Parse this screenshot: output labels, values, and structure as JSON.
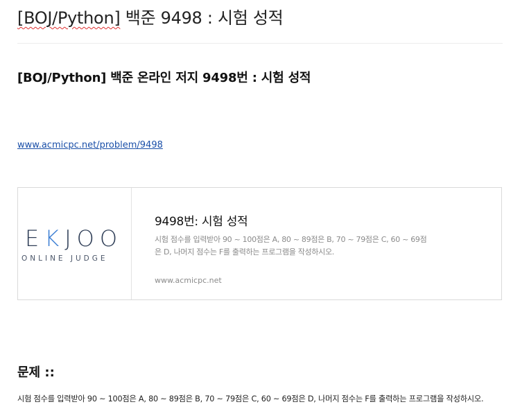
{
  "post": {
    "title_prefix": "[BOJ/Python]",
    "title_rest": " 백준 9498 : 시험 성적",
    "subheading": "[BOJ/Python] 백준 온라인 저지 9498번 : 시험 성적",
    "link_text": "www.acmicpc.net/problem/9498"
  },
  "card": {
    "logo_main_pre": "E",
    "logo_main_k": "K",
    "logo_main_post": "JOO",
    "logo_sub": "ONLINE JUDGE",
    "title": "9498번: 시험 성적",
    "description": "시험 점수를 입력받아 90 ~ 100점은 A, 80 ~ 89점은 B, 70 ~ 79점은 C, 60 ~ 69점은 D, 나머지 점수는 F를 출력하는 프로그램을 작성하시오.",
    "url": "www.acmicpc.net"
  },
  "section": {
    "heading": "문제 ::",
    "body": "시험 점수를 입력받아 90 ~ 100점은 A, 80 ~ 89점은 B, 70 ~ 79점은 C, 60 ~ 69점은 D, 나머지 점수는 F를 출력하는 프로그램을 작성하시오."
  },
  "colors": {
    "link": "#1a4fa8",
    "logo_dark": "#2f3e57",
    "logo_accent": "#3d7fd4",
    "muted_text": "#8a8a8a"
  }
}
